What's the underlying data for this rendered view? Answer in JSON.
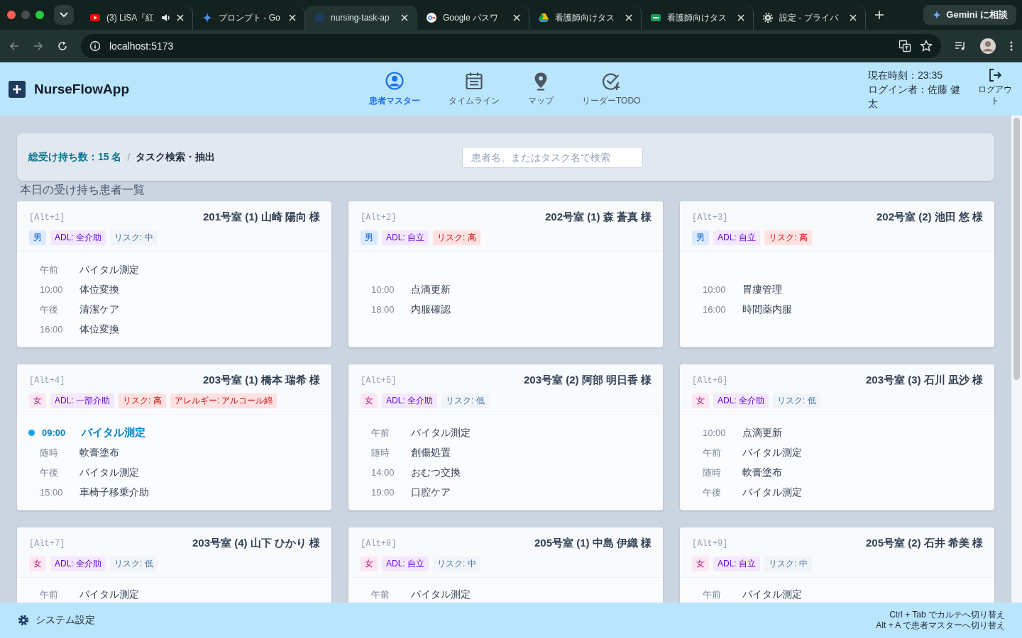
{
  "browser": {
    "tabs": [
      {
        "title": "(3) LiSA『紅",
        "selected": false,
        "audio": true
      },
      {
        "title": "プロンプト - Go",
        "selected": false,
        "audio": false
      },
      {
        "title": "nursing-task-ap",
        "selected": true,
        "audio": false
      },
      {
        "title": "Google パスワ",
        "selected": false,
        "audio": false
      },
      {
        "title": "看護師向けタス",
        "selected": false,
        "audio": false
      },
      {
        "title": "看護師向けタス",
        "selected": false,
        "audio": false
      },
      {
        "title": "設定 - プライバ",
        "selected": false,
        "audio": false
      }
    ],
    "address": "localhost:5173",
    "gemini_button": "Gemini に相談"
  },
  "app": {
    "title": "NurseFlowApp",
    "nav": [
      {
        "label": "患者マスター",
        "selected": true
      },
      {
        "label": "タイムライン",
        "selected": false
      },
      {
        "label": "マップ",
        "selected": false
      },
      {
        "label": "リーダーTODO",
        "selected": false
      }
    ],
    "clock": "現在時刻：23:35",
    "user": "ログイン者：佐藤 健太",
    "logout": "ログアウト"
  },
  "toolbar": {
    "count": "総受け持ち数：15 名",
    "separator": "/",
    "title": "タスク検索・抽出",
    "search_placeholder": "患者名、またはタスク名で検索"
  },
  "section_title": "本日の受け持ち患者一覧",
  "patients": [
    {
      "shortcut": "[Alt+1]",
      "name": "201号室 (1) 山崎 陽向 様",
      "tags": [
        {
          "text": "男",
          "color": "#dbeafe"
        },
        {
          "text": "ADL: 全介助",
          "color": "#f3e8ff"
        },
        {
          "text": "リスク: 中",
          "color": "#f1f5f9"
        }
      ],
      "tasks": [
        {
          "time": "午前",
          "name": "バイタル測定",
          "current": false
        },
        {
          "time": "10:00",
          "name": "体位変換",
          "current": false
        },
        {
          "time": "午後",
          "name": "清潔ケア",
          "current": false
        },
        {
          "time": "16:00",
          "name": "体位変換",
          "current": false
        }
      ]
    },
    {
      "shortcut": "[Alt+2]",
      "name": "202号室 (1) 森 蒼真 様",
      "tags": [
        {
          "text": "男",
          "color": "#dbeafe"
        },
        {
          "text": "ADL: 自立",
          "color": "#f3e8ff"
        },
        {
          "text": "リスク: 高",
          "color": "#fee2e2"
        }
      ],
      "tasks": [
        {
          "time": "10:00",
          "name": "点滴更新",
          "current": false
        },
        {
          "time": "18:00",
          "name": "内服確認",
          "current": false
        }
      ]
    },
    {
      "shortcut": "[Alt+3]",
      "name": "202号室 (2) 池田 悠 様",
      "tags": [
        {
          "text": "男",
          "color": "#dbeafe"
        },
        {
          "text": "ADL: 自立",
          "color": "#f3e8ff"
        },
        {
          "text": "リスク: 高",
          "color": "#fee2e2"
        }
      ],
      "tasks": [
        {
          "time": "10:00",
          "name": "胃瘻管理",
          "current": false
        },
        {
          "time": "16:00",
          "name": "時間薬内服",
          "current": false
        }
      ]
    },
    {
      "shortcut": "[Alt+4]",
      "name": "203号室 (1) 橋本 瑞希 様",
      "tags": [
        {
          "text": "女",
          "color": "#fce7f3"
        },
        {
          "text": "ADL: 一部介助",
          "color": "#f3e8ff"
        },
        {
          "text": "リスク: 高",
          "color": "#fee2e2"
        },
        {
          "text": "アレルギー: アルコール綿",
          "color": "#fee2e2"
        }
      ],
      "tasks": [
        {
          "time": "09:00",
          "name": "バイタル測定",
          "current": true
        },
        {
          "time": "随時",
          "name": "軟膏塗布",
          "current": false
        },
        {
          "time": "午後",
          "name": "バイタル測定",
          "current": false
        },
        {
          "time": "15:00",
          "name": "車椅子移乗介助",
          "current": false
        }
      ]
    },
    {
      "shortcut": "[Alt+5]",
      "name": "203号室 (2) 阿部 明日香 様",
      "tags": [
        {
          "text": "女",
          "color": "#fce7f3"
        },
        {
          "text": "ADL: 全介助",
          "color": "#f3e8ff"
        },
        {
          "text": "リスク: 低",
          "color": "#f1f5f9"
        }
      ],
      "tasks": [
        {
          "time": "午前",
          "name": "バイタル測定",
          "current": false
        },
        {
          "time": "随時",
          "name": "創傷処置",
          "current": false
        },
        {
          "time": "14:00",
          "name": "おむつ交換",
          "current": false
        },
        {
          "time": "19:00",
          "name": "口腔ケア",
          "current": false
        }
      ]
    },
    {
      "shortcut": "[Alt+6]",
      "name": "203号室 (3) 石川 凪沙 様",
      "tags": [
        {
          "text": "女",
          "color": "#fce7f3"
        },
        {
          "text": "ADL: 全介助",
          "color": "#f3e8ff"
        },
        {
          "text": "リスク: 低",
          "color": "#f1f5f9"
        }
      ],
      "tasks": [
        {
          "time": "10:00",
          "name": "点滴更新",
          "current": false
        },
        {
          "time": "午前",
          "name": "バイタル測定",
          "current": false
        },
        {
          "time": "随時",
          "name": "軟膏塗布",
          "current": false
        },
        {
          "time": "午後",
          "name": "バイタル測定",
          "current": false
        }
      ]
    },
    {
      "shortcut": "[Alt+7]",
      "name": "203号室 (4) 山下 ひかり 様",
      "tags": [
        {
          "text": "女",
          "color": "#fce7f3"
        },
        {
          "text": "ADL: 全介助",
          "color": "#f3e8ff"
        },
        {
          "text": "リスク: 低",
          "color": "#f1f5f9"
        }
      ],
      "tasks": [
        {
          "time": "午前",
          "name": "バイタル測定",
          "current": false
        }
      ]
    },
    {
      "shortcut": "[Alt+8]",
      "name": "205号室 (1) 中島 伊織 様",
      "tags": [
        {
          "text": "女",
          "color": "#fce7f3"
        },
        {
          "text": "ADL: 自立",
          "color": "#f3e8ff"
        },
        {
          "text": "リスク: 中",
          "color": "#f1f5f9"
        }
      ],
      "tasks": [
        {
          "time": "午前",
          "name": "バイタル測定",
          "current": false
        }
      ]
    },
    {
      "shortcut": "[Alt+9]",
      "name": "205号室 (2) 石井 希美 様",
      "tags": [
        {
          "text": "女",
          "color": "#fce7f3"
        },
        {
          "text": "ADL: 自立",
          "color": "#f3e8ff"
        },
        {
          "text": "リスク: 中",
          "color": "#f1f5f9"
        }
      ],
      "tasks": [
        {
          "time": "午前",
          "name": "バイタル測定",
          "current": false
        }
      ]
    }
  ],
  "footer": {
    "settings": "システム設定",
    "hints": [
      "Ctrl + Tab でカルテへ切り替え",
      "Alt + A で患者マスターへ切り替え"
    ]
  }
}
